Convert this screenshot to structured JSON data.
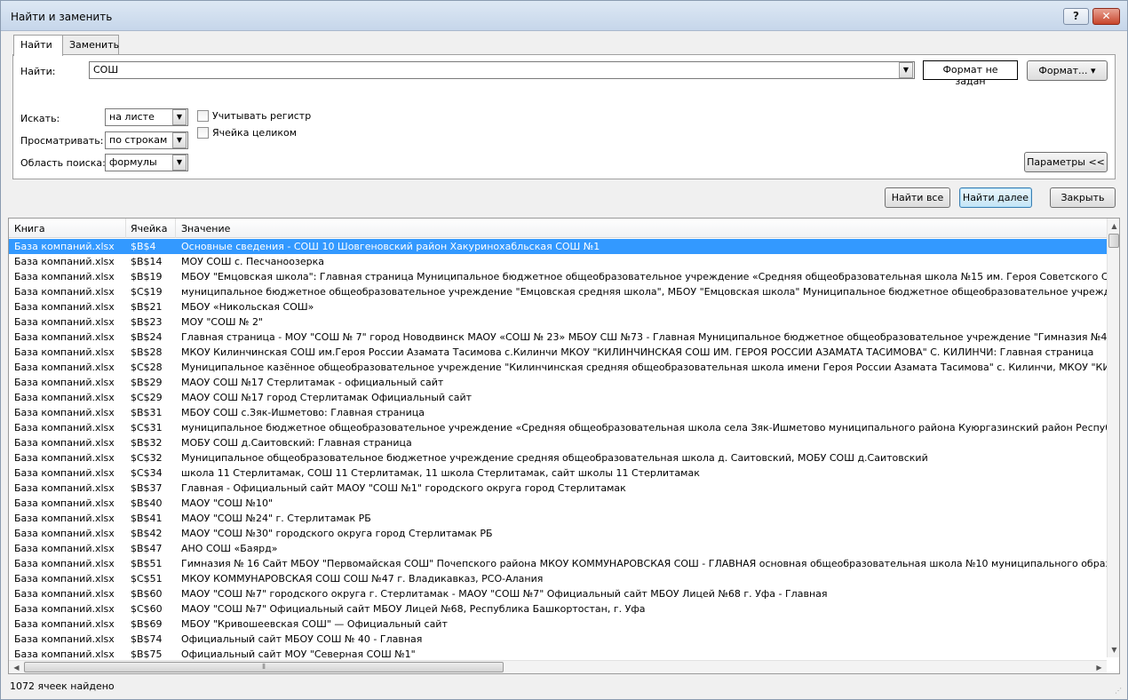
{
  "window": {
    "title": "Найти и заменить",
    "help": "?",
    "close": "✕"
  },
  "tabs": [
    {
      "label": "Найти"
    },
    {
      "label": "Заменить"
    }
  ],
  "find": {
    "label": "Найти:",
    "value": "СОШ",
    "format_status": "Формат не задан",
    "format_button": "Формат... ▾"
  },
  "options": {
    "within_label": "Искать:",
    "within_value": "на листе",
    "search_label": "Просматривать:",
    "search_value": "по строкам",
    "lookin_label": "Область поиска:",
    "lookin_value": "формулы",
    "match_case": "Учитывать регистр",
    "match_entire": "Ячейка целиком",
    "params_button": "Параметры <<"
  },
  "buttons": {
    "find_all": "Найти все",
    "find_next": "Найти далее",
    "close": "Закрыть"
  },
  "results": {
    "columns": [
      "Книга",
      "Ячейка",
      "Значение"
    ],
    "rows": [
      {
        "book": "База компаний.xlsx",
        "cell": "$B$4",
        "value": "Основные сведения - СОШ 10 Шовгеновский район Хакуринохабльская СОШ №1"
      },
      {
        "book": "База компаний.xlsx",
        "cell": "$B$14",
        "value": "МОУ СОШ с. Песчаноозерка"
      },
      {
        "book": "База компаний.xlsx",
        "cell": "$B$19",
        "value": "МБОУ \"Емцовская школа\": Главная страница Муниципальное бюджетное общеобразовательное учреждение «Средняя общеобразовательная школа №15 им. Героя Советского Союза В. Т. Чванова» г. Е"
      },
      {
        "book": "База компаний.xlsx",
        "cell": "$C$19",
        "value": "муниципальное бюджетное общеобразовательное учреждение \"Емцовская средняя школа\", МБОУ \"Емцовская школа\" Муниципальное бюджетное общеобразовательное учреждение «Средняя общеобра"
      },
      {
        "book": "База компаний.xlsx",
        "cell": "$B$21",
        "value": "МБОУ «Никольская СОШ»"
      },
      {
        "book": "База компаний.xlsx",
        "cell": "$B$23",
        "value": "МОУ \"СОШ № 2\""
      },
      {
        "book": "База компаний.xlsx",
        "cell": "$B$24",
        "value": "Главная страница - МОУ \"СОШ № 7\" город Новодвинск МАОУ «СОШ № 23» МБОУ СШ №73 - Главная Муниципальное бюджетное общеобразовательное учреждение \"Гимназия №4 г.Вельска\"."
      },
      {
        "book": "База компаний.xlsx",
        "cell": "$B$28",
        "value": "МКОУ Килинчинская СОШ им.Героя России Азамата Тасимова с.Килинчи МКОУ \"КИЛИНЧИНСКАЯ СОШ ИМ. ГЕРОЯ РОССИИ АЗАМАТА ТАСИМОВА\" С. КИЛИНЧИ: Главная страница"
      },
      {
        "book": "База компаний.xlsx",
        "cell": "$C$28",
        "value": "Муниципальное казённое общеобразовательное учреждение \"Килинчинская средняя общеобразовательная школа имени Героя России Азамата Тасимова\" с. Килинчи, МКОУ \"КИЛИНЧИНСКАЯ СОШ ИМ. Г"
      },
      {
        "book": "База компаний.xlsx",
        "cell": "$B$29",
        "value": "МАОУ СОШ №17 Стерлитамак - официальный сайт"
      },
      {
        "book": "База компаний.xlsx",
        "cell": "$C$29",
        "value": "МАОУ СОШ №17 город Стерлитамак Официальный сайт"
      },
      {
        "book": "База компаний.xlsx",
        "cell": "$B$31",
        "value": "МБОУ СОШ с.Зяк-Ишметово: Главная страница"
      },
      {
        "book": "База компаний.xlsx",
        "cell": "$C$31",
        "value": "муниципальное бюджетное общеобразовательное учреждение «Средняя общеобразовательная школа села Зяк-Ишметово муниципального района Куюргазинский район Республики Башкортостан», МБ"
      },
      {
        "book": "База компаний.xlsx",
        "cell": "$B$32",
        "value": "МОБУ СОШ д.Саитовский: Главная страница"
      },
      {
        "book": "База компаний.xlsx",
        "cell": "$C$32",
        "value": "Муниципальное общеобразовательное бюджетное учреждение средняя общеобразовательная школа д. Саитовский, МОБУ СОШ д.Саитовский"
      },
      {
        "book": "База компаний.xlsx",
        "cell": "$C$34",
        "value": "школа 11 Стерлитамак, СОШ 11 Стерлитамак, 11 школа Стерлитамак, сайт школы 11 Стерлитамак"
      },
      {
        "book": "База компаний.xlsx",
        "cell": "$B$37",
        "value": "Главная - Официальный сайт МАОУ \"СОШ №1\" городского округа город Стерлитамак"
      },
      {
        "book": "База компаний.xlsx",
        "cell": "$B$40",
        "value": "МАОУ \"СОШ №10\""
      },
      {
        "book": "База компаний.xlsx",
        "cell": "$B$41",
        "value": "МАОУ \"СОШ №24\" г. Стерлитамак РБ"
      },
      {
        "book": "База компаний.xlsx",
        "cell": "$B$42",
        "value": "МАОУ \"СОШ №30\" городского округа город Стерлитамак РБ"
      },
      {
        "book": "База компаний.xlsx",
        "cell": "$B$47",
        "value": "АНО СОШ «Баярд»"
      },
      {
        "book": "База компаний.xlsx",
        "cell": "$B$51",
        "value": "Гимназия № 16 Сайт МБОУ \"Первомайская СОШ\" Почепского района МКОУ КОММУНАРОВСКАЯ СОШ - ГЛАВНАЯ основная общеобразовательная школа №10 муниципального образования город-курорт Ге"
      },
      {
        "book": "База компаний.xlsx",
        "cell": "$C$51",
        "value": "МКОУ КОММУНАРОВСКАЯ СОШ СОШ №47 г. Владикавказ, РСО-Алания"
      },
      {
        "book": "База компаний.xlsx",
        "cell": "$B$60",
        "value": "МАОУ \"СОШ №7\" городского округа г. Стерлитамак - МАОУ \"СОШ №7\" Официальный сайт МБОУ Лицей №68 г. Уфа - Главная"
      },
      {
        "book": "База компаний.xlsx",
        "cell": "$C$60",
        "value": "МАОУ \"СОШ №7\" Официальный сайт МБОУ Лицей №68, Республика Башкортостан, г. Уфа"
      },
      {
        "book": "База компаний.xlsx",
        "cell": "$B$69",
        "value": "МБОУ \"Кривошеевская СОШ\" — Официальный сайт"
      },
      {
        "book": "База компаний.xlsx",
        "cell": "$B$74",
        "value": "Официальный сайт МБОУ СОШ № 40 - Главная"
      },
      {
        "book": "База компаний.xlsx",
        "cell": "$B$75",
        "value": "Официальный сайт МОУ \"Северная СОШ №1\""
      }
    ]
  },
  "status": "1072 ячеек найдено",
  "colors": {
    "selection": "#3399ff",
    "title_bar": "#c6d6ea"
  }
}
